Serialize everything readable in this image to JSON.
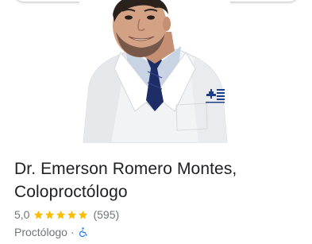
{
  "place": {
    "name_line1": "Dr. Emerson Romero Montes,",
    "name_line2": "Coloproctólogo",
    "rating": "5,0",
    "stars": 5,
    "review_count": "(595)",
    "category": "Proctólogo",
    "separator": "·"
  },
  "icons": {
    "star": "star-icon",
    "accessibility": "wheelchair-accessible-icon"
  },
  "colors": {
    "star": "#fbbc04",
    "accessibility": "#1a73e8",
    "title": "#202124",
    "secondary": "#70757a"
  }
}
